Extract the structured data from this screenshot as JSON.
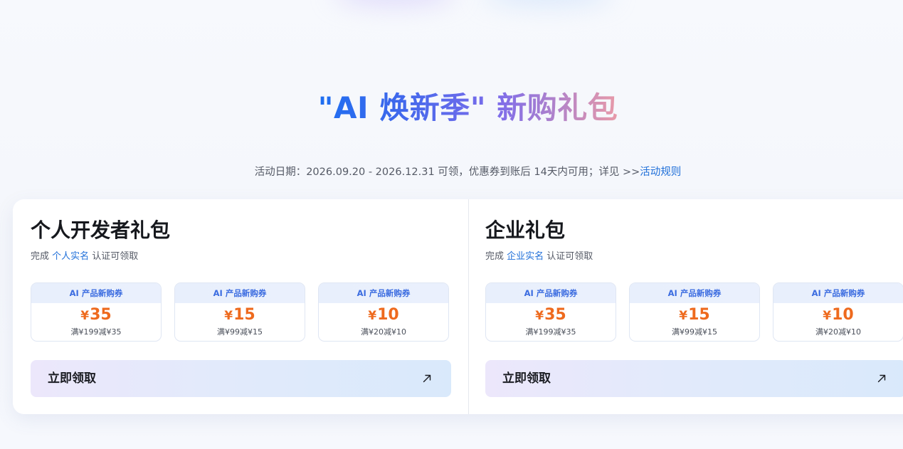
{
  "hero": {
    "title": "\"AI 焕新季\" 新购礼包"
  },
  "subtitle": {
    "text": "活动日期：2026.09.20 - 2026.12.31 可领，优惠券到账后 14天内可用；详见 >>",
    "link": "活动规则"
  },
  "packs": [
    {
      "title": "个人开发者礼包",
      "desc_prefix": "完成 ",
      "desc_link": "个人实名",
      "desc_suffix": " 认证可领取",
      "coupons": [
        {
          "label": "AI 产品新购券",
          "currency": "¥",
          "amount": "35",
          "condition": "满¥199减¥35"
        },
        {
          "label": "AI 产品新购券",
          "currency": "¥",
          "amount": "15",
          "condition": "满¥99减¥15"
        },
        {
          "label": "AI 产品新购券",
          "currency": "¥",
          "amount": "10",
          "condition": "满¥20减¥10"
        }
      ],
      "button_label": "立即领取",
      "button_icon": "arrow-up-right-icon"
    },
    {
      "title": "企业礼包",
      "desc_prefix": "完成 ",
      "desc_link": "企业实名",
      "desc_suffix": " 认证可领取",
      "coupons": [
        {
          "label": "AI 产品新购券",
          "currency": "¥",
          "amount": "35",
          "condition": "满¥199减¥35"
        },
        {
          "label": "AI 产品新购券",
          "currency": "¥",
          "amount": "15",
          "condition": "满¥99减¥15"
        },
        {
          "label": "AI 产品新购券",
          "currency": "¥",
          "amount": "10",
          "condition": "满¥20减¥10"
        }
      ],
      "button_label": "立即领取",
      "button_icon": "arrow-up-right-icon"
    }
  ],
  "colors": {
    "link": "#1f6fd9",
    "coupon_amount": "#ee6a1e",
    "coupon_label": "#3b6ce0",
    "title_gradient": [
      "#1e6ff1",
      "#7d6cea",
      "#e89aa8"
    ]
  }
}
